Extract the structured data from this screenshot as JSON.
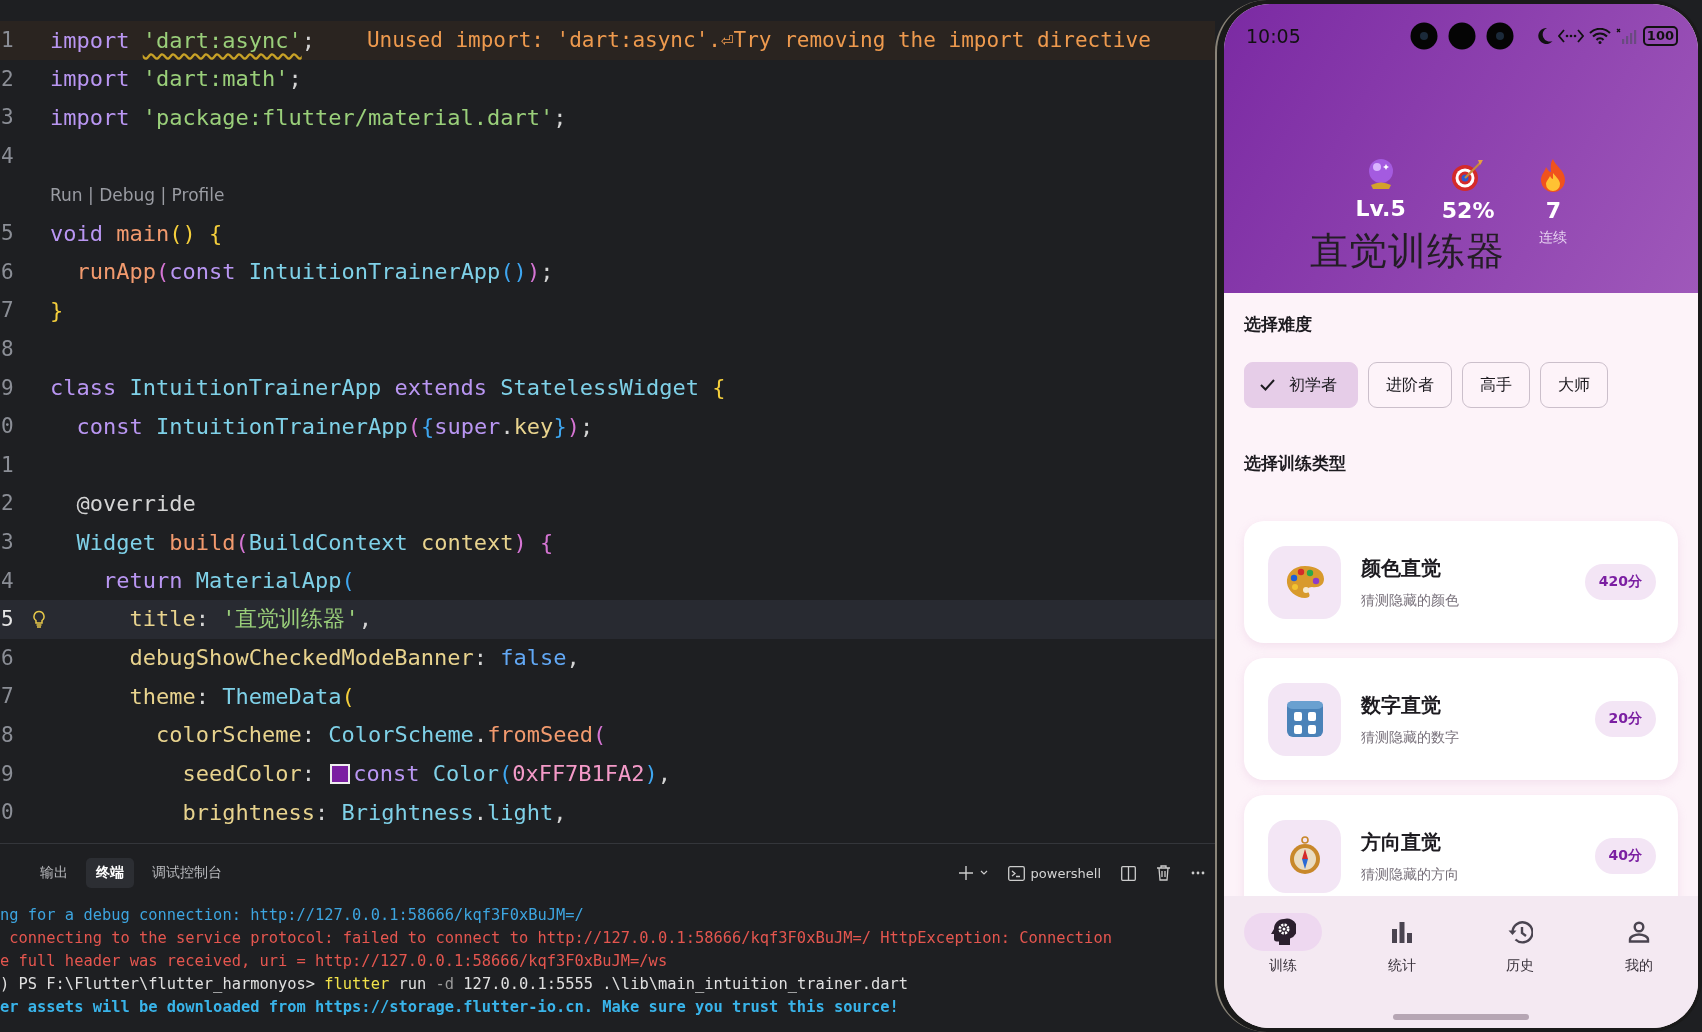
{
  "editor": {
    "lines": [
      {
        "kind": "code",
        "number": "1",
        "warning": true,
        "tokens": [
          {
            "t": "import ",
            "kind": "kw"
          },
          {
            "t": "'dart:async'",
            "kind": "str",
            "squiggle": true
          },
          {
            "t": ";",
            "kind": "plain"
          }
        ],
        "diagnostic": "Unused import: 'dart:async'.⏎Try removing the import directive"
      },
      {
        "kind": "code",
        "number": "2",
        "tokens": [
          {
            "t": "import ",
            "kind": "kw"
          },
          {
            "t": "'dart:math'",
            "kind": "str"
          },
          {
            "t": ";",
            "kind": "plain"
          }
        ]
      },
      {
        "kind": "code",
        "number": "3",
        "tokens": [
          {
            "t": "import ",
            "kind": "kw"
          },
          {
            "t": "'package:flutter/material.dart'",
            "kind": "str"
          },
          {
            "t": ";",
            "kind": "plain"
          }
        ]
      },
      {
        "kind": "code",
        "number": "4"
      },
      {
        "kind": "codelens",
        "text": "Run | Debug | Profile"
      },
      {
        "kind": "code",
        "number": "5",
        "tokens": [
          {
            "t": "void ",
            "kind": "kw"
          },
          {
            "t": "main",
            "kind": "fn"
          },
          {
            "t": "() {",
            "kind": "b1"
          }
        ]
      },
      {
        "kind": "code",
        "number": "6",
        "tokens": [
          {
            "t": "  runApp",
            "kind": "fn"
          },
          {
            "t": "(",
            "kind": "b2"
          },
          {
            "t": "const ",
            "kind": "kw"
          },
          {
            "t": "IntuitionTrainerApp",
            "kind": "type"
          },
          {
            "t": "()",
            "kind": "b3"
          },
          {
            "t": ")",
            "kind": "b2"
          },
          {
            "t": ";",
            "kind": "plain"
          }
        ]
      },
      {
        "kind": "code",
        "number": "7",
        "tokens": [
          {
            "t": "}",
            "kind": "b1"
          }
        ]
      },
      {
        "kind": "code",
        "number": "8"
      },
      {
        "kind": "code",
        "number": "9",
        "tokens": [
          {
            "t": "class ",
            "kind": "kw"
          },
          {
            "t": "IntuitionTrainerApp ",
            "kind": "type"
          },
          {
            "t": "extends ",
            "kind": "kw"
          },
          {
            "t": "StatelessWidget ",
            "kind": "type"
          },
          {
            "t": "{",
            "kind": "b1"
          }
        ]
      },
      {
        "kind": "code",
        "number": "0",
        "tokens": [
          {
            "t": "  const ",
            "kind": "kw"
          },
          {
            "t": "IntuitionTrainerApp",
            "kind": "type"
          },
          {
            "t": "(",
            "kind": "b2"
          },
          {
            "t": "{",
            "kind": "b3"
          },
          {
            "t": "super",
            "kind": "kw"
          },
          {
            "t": ".",
            "kind": "plain"
          },
          {
            "t": "key",
            "kind": "prop"
          },
          {
            "t": "}",
            "kind": "b3"
          },
          {
            "t": ")",
            "kind": "b2"
          },
          {
            "t": ";",
            "kind": "plain"
          }
        ]
      },
      {
        "kind": "code",
        "number": "1"
      },
      {
        "kind": "code",
        "number": "2",
        "tokens": [
          {
            "t": "  @override",
            "kind": "plain"
          }
        ]
      },
      {
        "kind": "code",
        "number": "3",
        "tokens": [
          {
            "t": "  Widget ",
            "kind": "type"
          },
          {
            "t": "build",
            "kind": "fn"
          },
          {
            "t": "(",
            "kind": "b2"
          },
          {
            "t": "BuildContext ",
            "kind": "type"
          },
          {
            "t": "context",
            "kind": "prop"
          },
          {
            "t": ") {",
            "kind": "b2"
          }
        ]
      },
      {
        "kind": "code",
        "number": "4",
        "tokens": [
          {
            "t": "    return ",
            "kind": "kw"
          },
          {
            "t": "MaterialApp",
            "kind": "type"
          },
          {
            "t": "(",
            "kind": "b3"
          }
        ]
      },
      {
        "kind": "code",
        "number": "5",
        "current": true,
        "lightbulb": true,
        "tokens": [
          {
            "t": "      title",
            "kind": "prop"
          },
          {
            "t": ": ",
            "kind": "plain"
          },
          {
            "t": "'直觉训练器'",
            "kind": "str"
          },
          {
            "t": ",",
            "kind": "plain"
          }
        ]
      },
      {
        "kind": "code",
        "number": "6",
        "tokens": [
          {
            "t": "      debugShowCheckedModeBanner",
            "kind": "prop"
          },
          {
            "t": ": ",
            "kind": "plain"
          },
          {
            "t": "false",
            "kind": "lit"
          },
          {
            "t": ",",
            "kind": "plain"
          }
        ]
      },
      {
        "kind": "code",
        "number": "7",
        "tokens": [
          {
            "t": "      theme",
            "kind": "prop"
          },
          {
            "t": ": ",
            "kind": "plain"
          },
          {
            "t": "ThemeData",
            "kind": "type"
          },
          {
            "t": "(",
            "kind": "b1"
          }
        ]
      },
      {
        "kind": "code",
        "number": "8",
        "tokens": [
          {
            "t": "        colorScheme",
            "kind": "prop"
          },
          {
            "t": ": ",
            "kind": "plain"
          },
          {
            "t": "ColorScheme",
            "kind": "type"
          },
          {
            "t": ".",
            "kind": "plain"
          },
          {
            "t": "fromSeed",
            "kind": "fn"
          },
          {
            "t": "(",
            "kind": "b2"
          }
        ]
      },
      {
        "kind": "code",
        "number": "9",
        "tokens": [
          {
            "t": "          seedColor",
            "kind": "prop"
          },
          {
            "t": ": ",
            "kind": "plain"
          },
          {
            "kind": "swatch",
            "color": "#7b1fa2"
          },
          {
            "t": "const ",
            "kind": "kw"
          },
          {
            "t": "Color",
            "kind": "type"
          },
          {
            "t": "(",
            "kind": "b3"
          },
          {
            "t": "0xFF7B1FA2",
            "kind": "num"
          },
          {
            "t": ")",
            "kind": "b3"
          },
          {
            "t": ",",
            "kind": "plain"
          }
        ]
      },
      {
        "kind": "code",
        "number": "0",
        "tokens": [
          {
            "t": "          brightness",
            "kind": "prop"
          },
          {
            "t": ": ",
            "kind": "plain"
          },
          {
            "t": "Brightness",
            "kind": "type"
          },
          {
            "t": ".",
            "kind": "plain"
          },
          {
            "t": "light",
            "kind": "type"
          },
          {
            "t": ",",
            "kind": "plain"
          }
        ]
      }
    ]
  },
  "panel": {
    "tabs": [
      {
        "label": "输出",
        "selected": false
      },
      {
        "label": "终端",
        "selected": true
      },
      {
        "label": "调试控制台",
        "selected": false
      }
    ],
    "shell": "powershell",
    "lines": [
      {
        "segments": [
          {
            "t": "ng for a debug connection: http://127.0.0.1:58666/kqf3F0xBuJM=/",
            "kind": "info"
          }
        ]
      },
      {
        "segments": [
          {
            "t": " connecting to the service protocol: failed to connect to http://127.0.0.1:58666/kqf3F0xBuJM=/ HttpException: Connection",
            "kind": "error"
          }
        ]
      },
      {
        "segments": [
          {
            "t": "e full header was received, uri = http://127.0.0.1:58666/kqf3F0xBuJM=/ws",
            "kind": "error"
          }
        ]
      },
      {
        "segments": [
          {
            "t": ") PS F:\\Flutter\\flutter_harmonyos> ",
            "kind": "plain"
          },
          {
            "t": "flutter",
            "kind": "command"
          },
          {
            "t": " run ",
            "kind": "plain"
          },
          {
            "t": "-d",
            "kind": "flag"
          },
          {
            "t": " 127.0.0.1:5555 .\\lib\\main_intuition_trainer.dart",
            "kind": "plain"
          }
        ]
      },
      {
        "segments": [
          {
            "t": "er assets will be downloaded from https://storage.flutter-io.cn. Make sure you trust this source!",
            "kind": "notice"
          }
        ]
      }
    ]
  },
  "phone": {
    "status_bar": {
      "time": "10:05",
      "battery": "100"
    },
    "header": {
      "title": "直觉训练器",
      "stats": [
        {
          "kind": "crystal-ball",
          "value": "Lv.5"
        },
        {
          "kind": "target",
          "value": "52%"
        },
        {
          "kind": "fire",
          "value": "7",
          "label": "连续"
        }
      ]
    },
    "difficulty": {
      "heading": "选择难度",
      "options": [
        {
          "label": "初学者",
          "selected": true
        },
        {
          "label": "进阶者",
          "selected": false
        },
        {
          "label": "高手",
          "selected": false
        },
        {
          "label": "大师",
          "selected": false
        }
      ]
    },
    "training": {
      "heading": "选择训练类型",
      "cards": [
        {
          "kind": "palette",
          "title": "颜色直觉",
          "subtitle": "猜测隐藏的颜色",
          "score": "420分"
        },
        {
          "kind": "number-tile",
          "title": "数字直觉",
          "subtitle": "猜测隐藏的数字",
          "score": "20分"
        },
        {
          "kind": "compass",
          "title": "方向直觉",
          "subtitle": "猜测隐藏的方向",
          "score": "40分"
        }
      ]
    },
    "nav": [
      {
        "kind": "brain",
        "label": "训练",
        "selected": true
      },
      {
        "kind": "chart",
        "label": "统计",
        "selected": false
      },
      {
        "kind": "history",
        "label": "历史",
        "selected": false
      },
      {
        "kind": "person",
        "label": "我的",
        "selected": false
      }
    ]
  }
}
